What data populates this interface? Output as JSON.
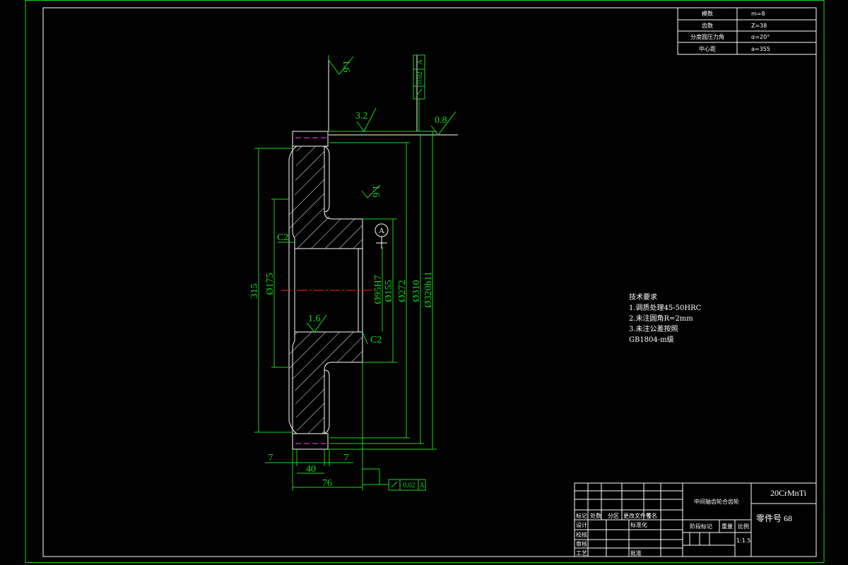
{
  "param_table": [
    {
      "label": "模数",
      "value": "m=8"
    },
    {
      "label": "齿数",
      "value": "Z=38"
    },
    {
      "label": "分度圆压力角",
      "value": "α=20°"
    },
    {
      "label": "中心距",
      "value": "a=355"
    }
  ],
  "dims": {
    "overall_height": "315",
    "d175": "Ø175",
    "d95": "Ø95H7",
    "d155": "Ø155",
    "d272": "Ø272",
    "d310": "Ø310",
    "d320": "Ø320h11",
    "w7_left": "7",
    "w7_right": "7",
    "w40": "40",
    "w76": "76",
    "chamfer_top": "C2",
    "chamfer_bottom": "C2",
    "datum": "A"
  },
  "roughness": {
    "r1": "1.6",
    "r2": "3.2",
    "r3": "0.8",
    "r4": "1.6",
    "r5": "1.6"
  },
  "tolerance": {
    "top_value": "0.02",
    "top_datum": "A",
    "bottom_value": "0.02",
    "bottom_datum": "A"
  },
  "notes": {
    "title": "技术要求",
    "line1": "1.调质处理45-50HRC",
    "line2": "2.未注圆角R=2mm",
    "line3": "3.未注公差按照",
    "line4": "GB1804-m级"
  },
  "title_block": {
    "part_name": "中间轴齿轮合齿轮",
    "material": "20CrMnTi",
    "part_no": "零件号 68",
    "scale": "1:1.5",
    "col_biaoji": "标记",
    "col_chushu": "处数",
    "col_fenqu": "分区",
    "col_gengai": "更改文件号",
    "col_qianming": "签名",
    "sheji": "设计",
    "biaozhunhua": "标准化",
    "jiaohe": "校核",
    "shenhe": "审核",
    "gongyi": "工艺",
    "pizhun": "批准",
    "jieduan": "阶段标记",
    "zhongliang": "重量",
    "bili": "比例"
  },
  "colors": {
    "outline": "#16d916",
    "geometry": "#ffffff",
    "centerline": "#ff2020",
    "hidden": "#ff40ff"
  }
}
